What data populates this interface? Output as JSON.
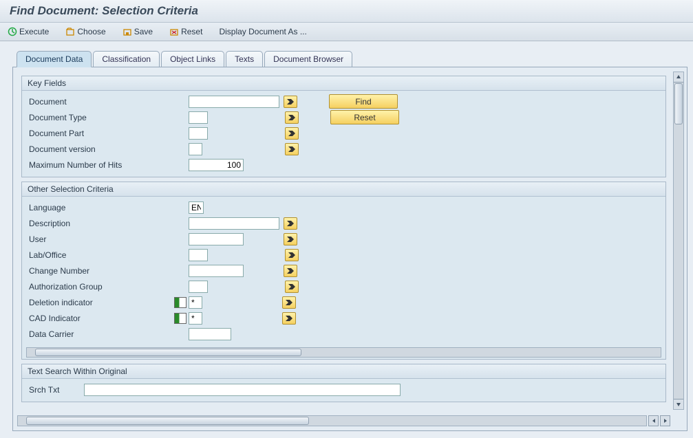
{
  "title": "Find Document: Selection Criteria",
  "toolbar": {
    "execute": "Execute",
    "choose": "Choose",
    "save": "Save",
    "reset": "Reset",
    "display": "Display Document As ..."
  },
  "tabs": {
    "document_data": "Document Data",
    "classification": "Classification",
    "object_links": "Object Links",
    "texts": "Texts",
    "document_browser": "Document Browser"
  },
  "groups": {
    "key_fields": {
      "title": "Key Fields",
      "document": "Document",
      "document_type": "Document Type",
      "document_part": "Document Part",
      "document_version": "Document version",
      "max_hits": "Maximum Number of Hits",
      "max_hits_value": "100"
    },
    "other": {
      "title": "Other Selection Criteria",
      "language": "Language",
      "language_value": "EN",
      "description": "Description",
      "user": "User",
      "lab_office": "Lab/Office",
      "change_number": "Change Number",
      "auth_group": "Authorization Group",
      "deletion_ind": "Deletion indicator",
      "cad_ind": "CAD Indicator",
      "data_carrier": "Data Carrier",
      "star": "*"
    },
    "text_search": {
      "title": "Text Search Within Original",
      "srch_txt": "Srch Txt"
    }
  },
  "buttons": {
    "find": "Find",
    "reset": "Reset"
  }
}
